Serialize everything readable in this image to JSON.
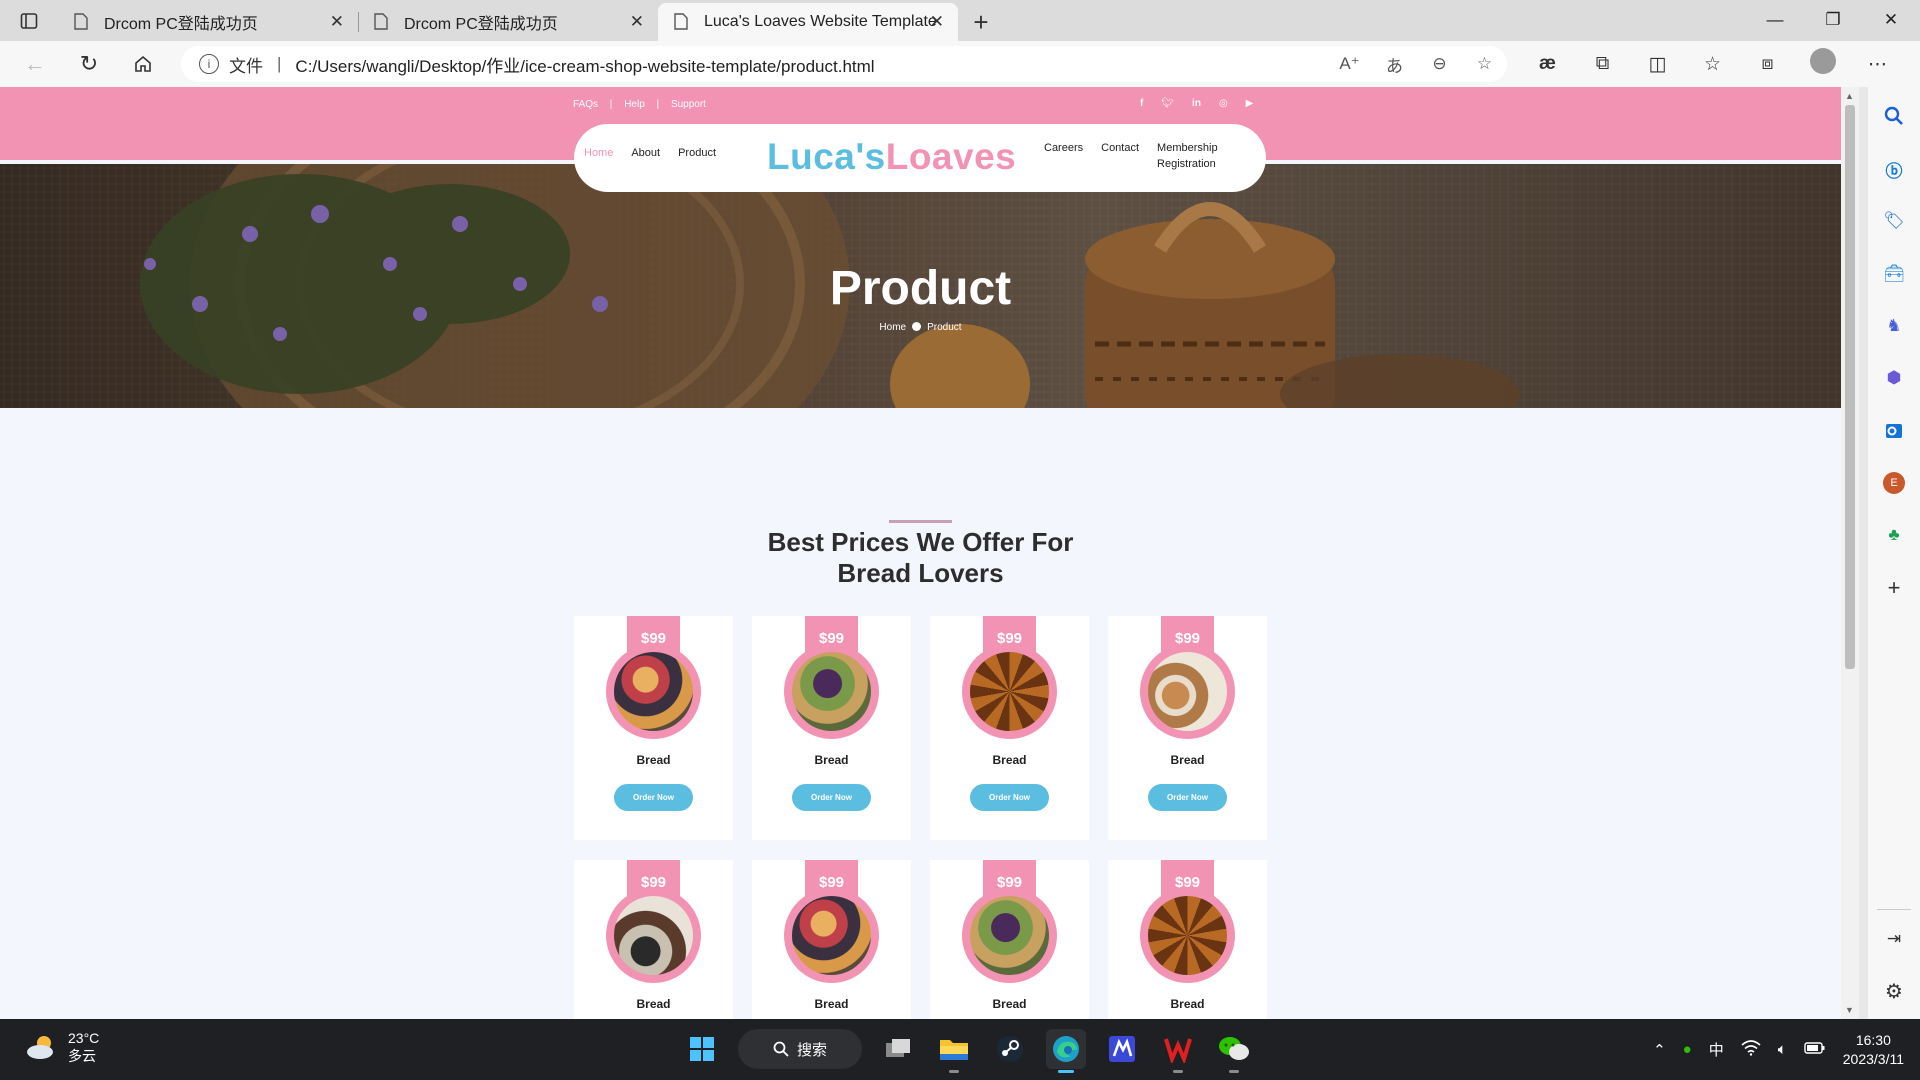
{
  "browser": {
    "tabs": [
      {
        "title": "Drcom PC登陆成功页",
        "active": false
      },
      {
        "title": "Drcom PC登陆成功页",
        "active": false
      },
      {
        "title": "Luca's Loaves Website Template",
        "active": true
      }
    ],
    "address": {
      "scheme_label": "文件",
      "url": "C:/Users/wangli/Desktop/作业/ice-cream-shop-website-template/product.html"
    }
  },
  "site": {
    "topbar": {
      "links": [
        "FAQs",
        "Help",
        "Support"
      ],
      "separator": "|"
    },
    "logo": {
      "part1": "Luca's",
      "part2": "Loaves"
    },
    "nav_left": [
      "Home",
      "About",
      "Product"
    ],
    "nav_right": {
      "careers": "Careers",
      "contact": "Contact",
      "membership": [
        "Membership",
        "Registration"
      ]
    },
    "hero": {
      "title": "Product",
      "breadcrumb": [
        "Home",
        "Product"
      ]
    },
    "section": {
      "title_line1": "Best Prices We Offer For",
      "title_line2": "Bread Lovers"
    },
    "products": [
      {
        "price": "$99",
        "name": "Bread",
        "cta": "Order Now"
      },
      {
        "price": "$99",
        "name": "Bread",
        "cta": "Order Now"
      },
      {
        "price": "$99",
        "name": "Bread",
        "cta": "Order Now"
      },
      {
        "price": "$99",
        "name": "Bread",
        "cta": "Order Now"
      },
      {
        "price": "$99",
        "name": "Bread"
      },
      {
        "price": "$99",
        "name": "Bread"
      },
      {
        "price": "$99",
        "name": "Bread"
      },
      {
        "price": "$99",
        "name": "Bread"
      }
    ],
    "colors": {
      "pink": "#f293b4",
      "blue": "#5bbde0",
      "page_bg": "#f3f6fd"
    }
  },
  "taskbar": {
    "weather": {
      "temp": "23°C",
      "condition": "多云"
    },
    "search_label": "搜索",
    "ime": "中",
    "time": "16:30",
    "date": "2023/3/11"
  }
}
